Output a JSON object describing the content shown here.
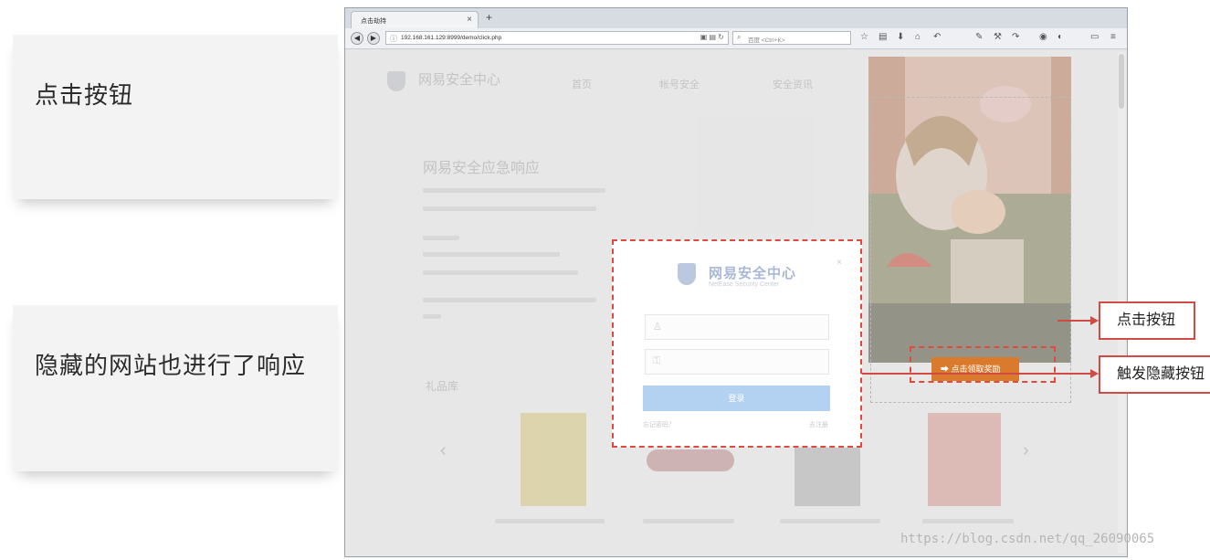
{
  "slide": {
    "card1": "点击按钮",
    "card2": "隐藏的网站也进行了响应"
  },
  "browser": {
    "tab_title": "点击劫持",
    "url": "192.168.161.129:8999/demo/click.php",
    "search_placeholder": "百度 <Ctrl+K>"
  },
  "page": {
    "site_name": "网易安全中心",
    "nav": [
      "首页",
      "帐号安全",
      "安全资讯"
    ],
    "headline": "网易安全应急响应",
    "section": "礼品库"
  },
  "dialog": {
    "title": "网易安全中心",
    "subtitle": "NetEase Security Center",
    "username_placeholder": "用户名",
    "password_placeholder": "密码",
    "login_button": "登录",
    "link_left": "忘记密码？",
    "link_right": "去注册"
  },
  "hidden_button": {
    "label": "点击领取奖励"
  },
  "callouts": {
    "click": "点击按钮",
    "trigger": "触发隐藏按钮"
  },
  "watermark": "https://blog.csdn.net/qq_26090065",
  "colors": {
    "highlight": "#e04a3c",
    "callout_border": "#d24a44",
    "orange_button": "#d97a2d",
    "login_button": "#b3d2f2"
  }
}
